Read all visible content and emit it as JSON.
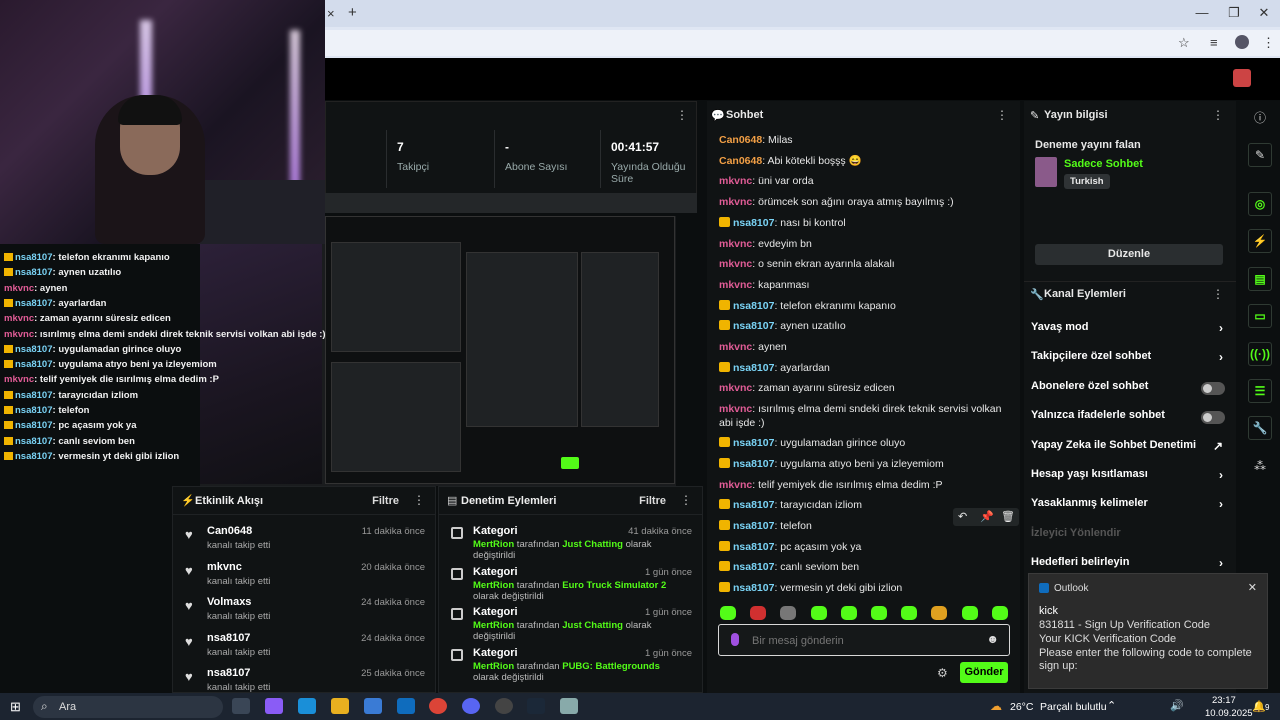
{
  "browser": {
    "tab_close": "×",
    "tab_new": "+",
    "win_min": "—",
    "win_max": "❐",
    "win_close": "✕"
  },
  "stats": {
    "followers_val": "7",
    "followers_lbl": "Takipçi",
    "subs_val": "-",
    "subs_lbl": "Abone Sayısı",
    "uptime_val": "00:41:57",
    "uptime_lbl": "Yayında Olduğu Süre"
  },
  "left_chat": [
    {
      "user": "nsa8107",
      "text": ": telefon ekranımı kapanıo",
      "color": "nsa",
      "crown": true
    },
    {
      "user": "nsa8107",
      "text": ": aynen uzatılıo",
      "color": "nsa",
      "crown": true
    },
    {
      "user": "mkvnc",
      "text": ": aynen",
      "color": "mk",
      "crown": false
    },
    {
      "user": "nsa8107",
      "text": ": ayarlardan",
      "color": "nsa",
      "crown": true
    },
    {
      "user": "mkvnc",
      "text": ": zaman ayarını süresiz edicen",
      "color": "mk",
      "crown": false
    },
    {
      "user": "mkvnc",
      "text": ": ısırılmış elma demi sndeki direk teknik servisi volkan abi işde :)",
      "color": "mk",
      "crown": false
    },
    {
      "user": "nsa8107",
      "text": ": uygulamadan girince oluyo",
      "color": "nsa",
      "crown": true
    },
    {
      "user": "nsa8107",
      "text": ": uygulama atıyo beni ya izleyemiom",
      "color": "nsa",
      "crown": true
    },
    {
      "user": "mkvnc",
      "text": ": telif yemiyek die ısırılmış elma dedim :P",
      "color": "mk",
      "crown": false
    },
    {
      "user": "nsa8107",
      "text": ": tarayıcıdan izliom",
      "color": "nsa",
      "crown": true
    },
    {
      "user": "nsa8107",
      "text": ": telefon",
      "color": "nsa",
      "crown": true
    },
    {
      "user": "nsa8107",
      "text": ": pc açasım yok ya",
      "color": "nsa",
      "crown": true
    },
    {
      "user": "nsa8107",
      "text": ": canlı seviom ben",
      "color": "nsa",
      "crown": true
    },
    {
      "user": "nsa8107",
      "text": ": vermesin yt deki gibi izlion",
      "color": "nsa",
      "crown": true
    }
  ],
  "activity": {
    "title": "Etkinlik Akışı",
    "filter": "Filtre",
    "events": [
      {
        "name": "Can0648",
        "sub": "kanalı takip etti",
        "time": "11 dakika önce"
      },
      {
        "name": "mkvnc",
        "sub": "kanalı takip etti",
        "time": "20 dakika önce"
      },
      {
        "name": "Volmaxs",
        "sub": "kanalı takip etti",
        "time": "24 dakika önce"
      },
      {
        "name": "nsa8107",
        "sub": "kanalı takip etti",
        "time": "24 dakika önce"
      },
      {
        "name": "nsa8107",
        "sub": "kanalı takip etti",
        "time": "25 dakika önce"
      }
    ]
  },
  "moderation": {
    "title": "Denetim Eylemleri",
    "filter": "Filtre",
    "items": [
      {
        "title": "Kategori",
        "who": "MertRion",
        "mid": " tarafından ",
        "cat": "Just Chatting",
        "end": " olarak değiştirildi",
        "time": "41 dakika önce"
      },
      {
        "title": "Kategori",
        "who": "MertRion",
        "mid": " tarafından ",
        "cat": "Euro Truck Simulator 2",
        "end": " olarak değiştirildi",
        "time": "1 gün önce"
      },
      {
        "title": "Kategori",
        "who": "MertRion",
        "mid": " tarafından ",
        "cat": "Just Chatting",
        "end": " olarak değiştirildi",
        "time": "1 gün önce"
      },
      {
        "title": "Kategori",
        "who": "MertRion",
        "mid": " tarafından ",
        "cat": "PUBG: Battlegrounds",
        "end": " olarak değiştirildi",
        "time": "1 gün önce"
      }
    ]
  },
  "chat": {
    "title": "Sohbet",
    "messages": [
      {
        "user": "Can0648",
        "text": ": Milas",
        "color": "can",
        "crown": false
      },
      {
        "user": "Can0648",
        "text": ": Abi kötekli boşşş 😄",
        "color": "can",
        "crown": false
      },
      {
        "user": "mkvnc",
        "text": ": üni var orda",
        "color": "mk",
        "crown": false
      },
      {
        "user": "mkvnc",
        "text": ": örümcek son ağını oraya atmış bayılmış :)",
        "color": "mk",
        "crown": false
      },
      {
        "user": "nsa8107",
        "text": ": nası bi kontrol",
        "color": "nsa",
        "crown": true
      },
      {
        "user": "mkvnc",
        "text": ": evdeyim bn",
        "color": "mk",
        "crown": false
      },
      {
        "user": "mkvnc",
        "text": ": o senin ekran ayarınla alakalı",
        "color": "mk",
        "crown": false
      },
      {
        "user": "mkvnc",
        "text": ": kapanması",
        "color": "mk",
        "crown": false
      },
      {
        "user": "nsa8107",
        "text": ": telefon ekranımı kapanıo",
        "color": "nsa",
        "crown": true
      },
      {
        "user": "nsa8107",
        "text": ": aynen uzatılıo",
        "color": "nsa",
        "crown": true
      },
      {
        "user": "mkvnc",
        "text": ": aynen",
        "color": "mk",
        "crown": false
      },
      {
        "user": "nsa8107",
        "text": ": ayarlardan",
        "color": "nsa",
        "crown": true
      },
      {
        "user": "mkvnc",
        "text": ": zaman ayarını süresiz edicen",
        "color": "mk",
        "crown": false
      },
      {
        "user": "mkvnc",
        "text": ": ısırılmış elma demi sndeki direk teknik servisi volkan abi işde :)",
        "color": "mk",
        "crown": false
      },
      {
        "user": "nsa8107",
        "text": ": uygulamadan girince oluyo",
        "color": "nsa",
        "crown": true
      },
      {
        "user": "nsa8107",
        "text": ": uygulama atıyo beni ya izleyemiom",
        "color": "nsa",
        "crown": true
      },
      {
        "user": "mkvnc",
        "text": ": telif yemiyek die ısırılmış elma dedim :P",
        "color": "mk",
        "crown": false
      },
      {
        "user": "nsa8107",
        "text": ": tarayıcıdan izliom",
        "color": "nsa",
        "crown": true
      },
      {
        "user": "nsa8107",
        "text": ": telefon",
        "color": "nsa",
        "crown": true
      },
      {
        "user": "nsa8107",
        "text": ": pc açasım yok ya",
        "color": "nsa",
        "crown": true
      },
      {
        "user": "nsa8107",
        "text": ": canlı seviom ben",
        "color": "nsa",
        "crown": true
      },
      {
        "user": "nsa8107",
        "text": ": vermesin yt deki gibi izlion",
        "color": "nsa",
        "crown": true
      }
    ],
    "placeholder": "Bir mesaj gönderin",
    "send": "Gönder"
  },
  "stream_info": {
    "title": "Yayın bilgisi",
    "stream_title": "Deneme yayını falan",
    "category": "Sadece Sohbet",
    "language": "Turkish",
    "edit": "Düzenle"
  },
  "channel_actions": {
    "title": "Kanal Eylemleri",
    "rows": [
      {
        "label": "Yavaş mod",
        "kind": "chevron"
      },
      {
        "label": "Takipçilere özel sohbet",
        "kind": "chevron"
      },
      {
        "label": "Abonelere özel sohbet",
        "kind": "toggle"
      },
      {
        "label": "Yalnızca ifadelerle sohbet",
        "kind": "toggle"
      },
      {
        "label": "Yapay Zeka ile Sohbet Denetimi",
        "kind": "external"
      },
      {
        "label": "Hesap yaşı kısıtlaması",
        "kind": "chevron"
      },
      {
        "label": "Yasaklanmış kelimeler",
        "kind": "chevron"
      },
      {
        "label": "İzleyici Yönlendir",
        "kind": "disabled"
      },
      {
        "label": "Hedefleri belirleyin",
        "kind": "chevron"
      }
    ]
  },
  "toast": {
    "app": "Outlook",
    "sender": "kick",
    "subject": "831811 - Sign Up Verification Code",
    "line1": "Your KICK Verification Code",
    "line2": "Please enter the following code to complete sign up:"
  },
  "taskbar": {
    "search": "Ara",
    "weather": "26°C",
    "weather_text": "Parçalı bulutlu",
    "time": "23:17",
    "date": "10.09.2025",
    "notif_count": "9"
  },
  "colors": {
    "accent": "#53fc18",
    "can": "#f29f45",
    "mk": "#e05c96",
    "nsa": "#7ad3f5",
    "crown": "#f0b400"
  }
}
